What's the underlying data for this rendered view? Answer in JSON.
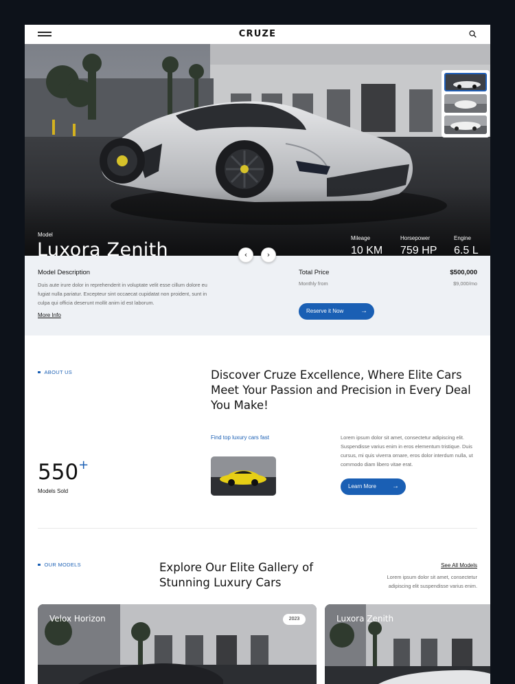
{
  "header": {
    "logo": "CRUZE"
  },
  "hero": {
    "model_label": "Model",
    "model_name": "Luxora Zenith",
    "specs": [
      {
        "key": "Mileage",
        "value": "10 KM"
      },
      {
        "key": "Horsepower",
        "value": "759 HP"
      },
      {
        "key": "Engine",
        "value": "6.5 L"
      }
    ]
  },
  "details": {
    "desc_title": "Model Description",
    "desc_text": "Duis aute irure dolor in reprehenderit in voluptate velit esse cillum dolore eu fugiat nulla pariatur. Excepteur sint occaecat cupidatat non proident, sunt in culpa qui officia deserunt mollit anim id est laborum.",
    "more_info": "More Info",
    "total_price_label": "Total Price",
    "total_price": "$500,000",
    "monthly_label": "Monthly from",
    "monthly_price": "$9,000/mo",
    "reserve_button": "Reserve it Now"
  },
  "about": {
    "tag": "ABOUT US",
    "headline": "Discover Cruze Excellence, Where Elite Cars Meet Your Passion and Precision in Every Deal You Make!",
    "stat_number": "550",
    "stat_plus": "+",
    "stat_label": "Models Sold",
    "find_text": "Find top luxury cars fast",
    "paragraph": "Lorem ipsum dolor sit amet, consectetur adipiscing elit. Suspendisse varius enim in eros elementum tristique. Duis cursus, mi quis viverra ornare, eros dolor interdum nulla, ut commodo diam libero vitae erat.",
    "learn_button": "Learn More"
  },
  "models": {
    "tag": "OUR MODELS",
    "headline": "Explore Our Elite Gallery of Stunning Luxury Cars",
    "see_all": "See All Models",
    "intro": "Lorem ipsum dolor sit amet, consectetur adipiscing elit suspendisse varius enim.",
    "cards": [
      {
        "title": "Velox Horizon",
        "year": "2023"
      },
      {
        "title": "Luxora Zenith"
      }
    ]
  },
  "colors": {
    "accent": "#1a5fb4",
    "page_bg": "#0d121a",
    "band_bg": "#eef1f5"
  },
  "icons": {
    "menu": "menu-icon",
    "search": "search-icon",
    "prev": "chevron-left-icon",
    "next": "chevron-right-icon",
    "arrow": "arrow-right-icon"
  }
}
